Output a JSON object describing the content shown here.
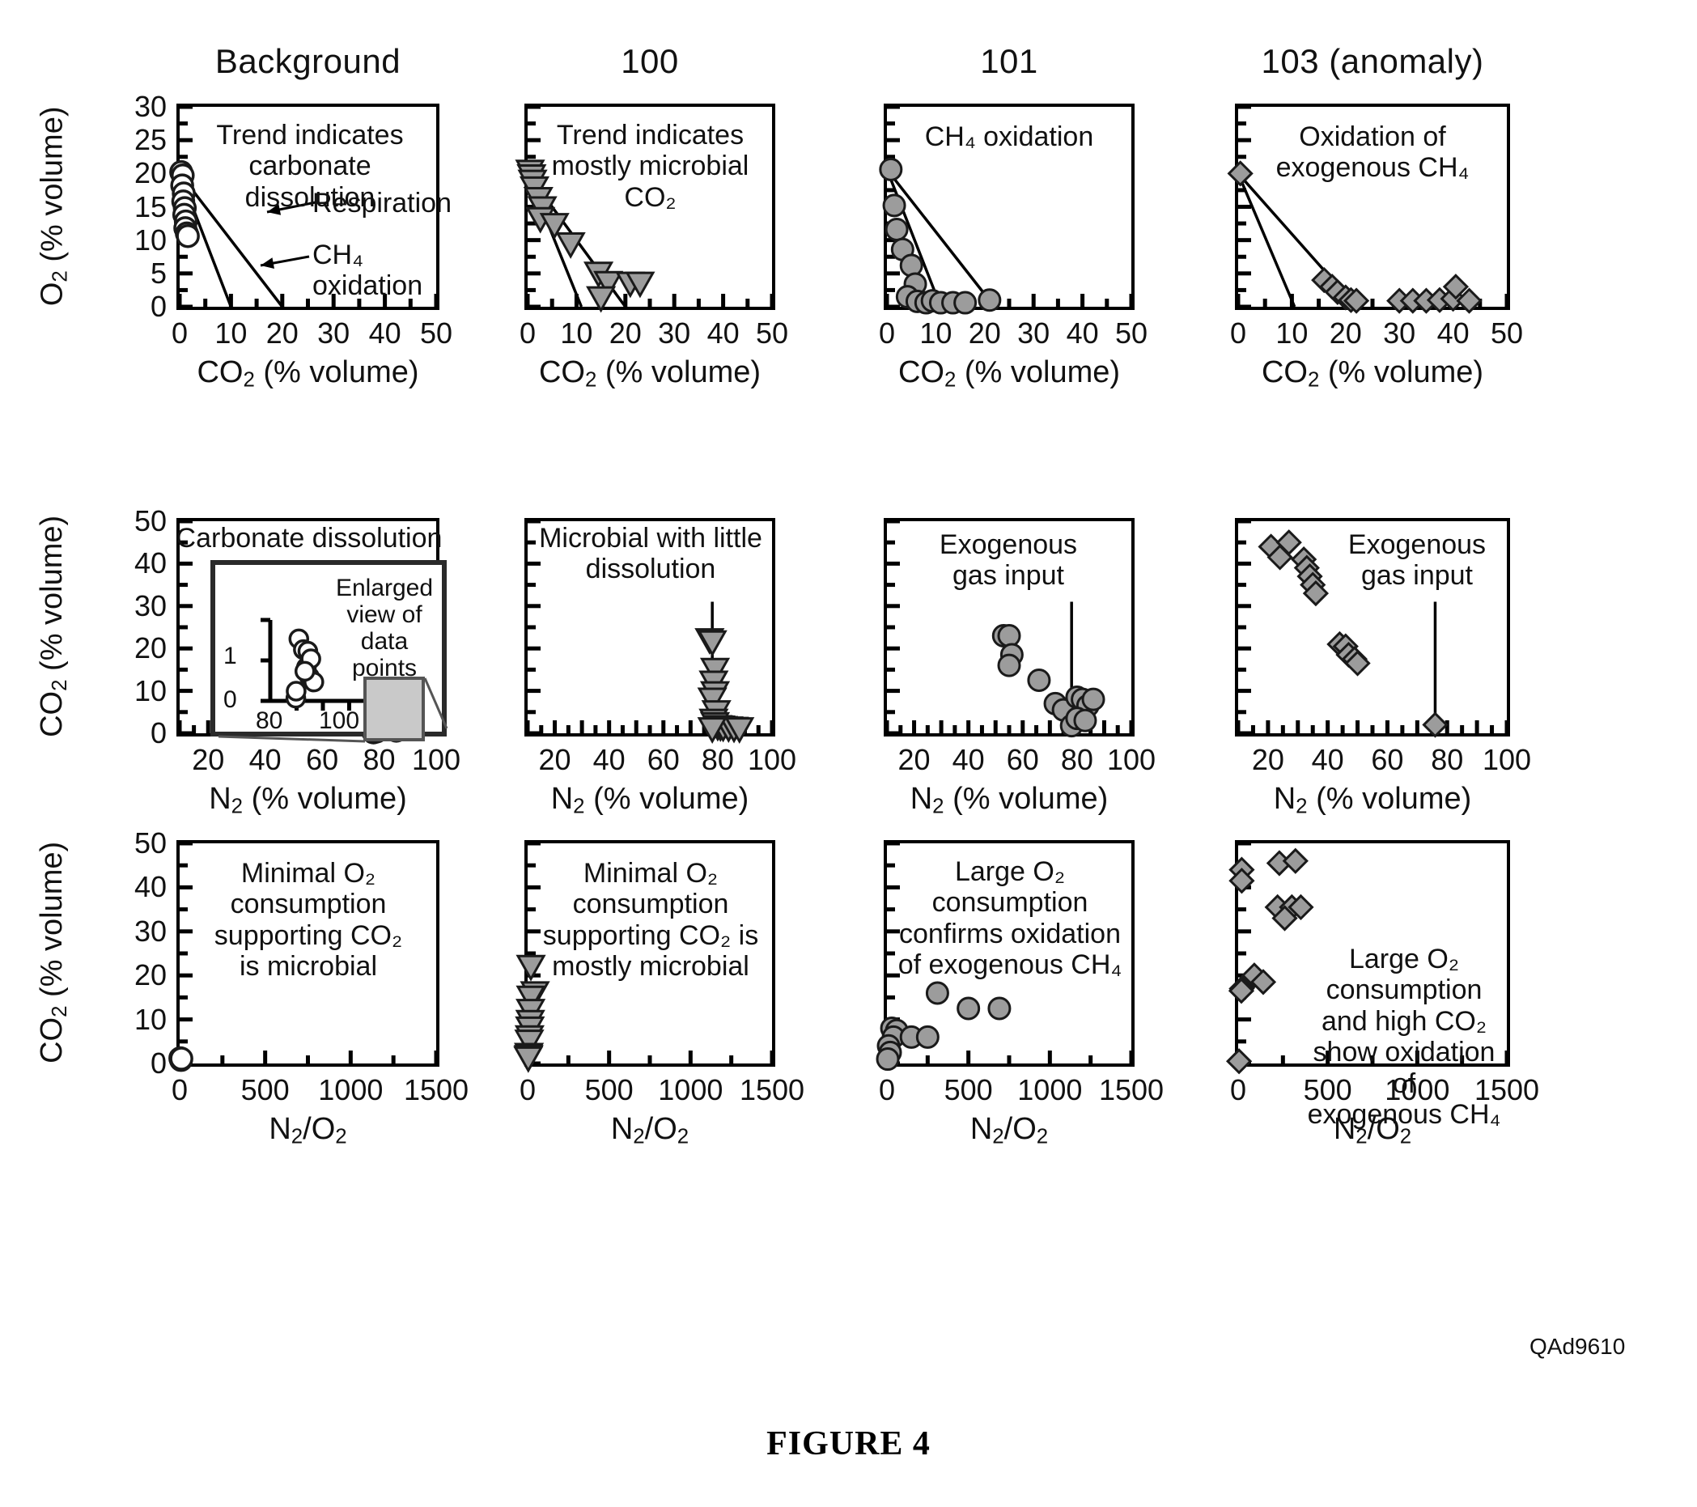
{
  "figure": {
    "caption": "FIGURE 4",
    "code": "QAd9610"
  },
  "columns": [
    {
      "id": "background",
      "title": "Background",
      "marker": "open-circle"
    },
    {
      "id": "site100",
      "title": "100",
      "marker": "triangle-down"
    },
    {
      "id": "site101",
      "title": "101",
      "marker": "filled-circle"
    },
    {
      "id": "site103",
      "title": "103 (anomaly)",
      "marker": "diamond"
    }
  ],
  "axes": {
    "co2_title": "CO₂ (% volume)",
    "o2_title": "O₂ (% volume)",
    "n2_title": "N₂ (% volume)",
    "ratio_title": "N₂/O₂",
    "row1_x_ticks": [
      "0",
      "10",
      "20",
      "30",
      "40",
      "50"
    ],
    "row1_y_ticks": [
      "0",
      "5",
      "10",
      "15",
      "20",
      "25",
      "30"
    ],
    "row2_x_ticks": [
      "20",
      "40",
      "60",
      "80",
      "100"
    ],
    "row2_y_ticks": [
      "0",
      "10",
      "20",
      "30",
      "40",
      "50"
    ],
    "row3_x_ticks": [
      "0",
      "500",
      "1000",
      "1500"
    ],
    "row3_y_ticks": [
      "0",
      "10",
      "20",
      "30",
      "40",
      "50"
    ]
  },
  "inset": {
    "label": "Enlarged\nview of\ndata\npoints",
    "y_ticks": [
      "0",
      "1"
    ],
    "x_ticks": [
      "80",
      "100"
    ]
  },
  "annotations": {
    "r1c1": "Trend indicates\ncarbonate\ndissolution",
    "r1c1_line1": "Respiration",
    "r1c1_line2": "CH₄\noxidation",
    "r1c2": "Trend indicates\nmostly microbial\nCO₂",
    "r1c3": "CH₄ oxidation",
    "r1c4": "Oxidation of\nexogenous CH₄",
    "r2c1": "Carbonate dissolution",
    "r2c2": "Microbial with little\ndissolution",
    "r2c3": "Exogenous\ngas input",
    "r2c4": "Exogenous\ngas input",
    "r3c1": "Minimal O₂\nconsumption\nsupporting CO₂\nis microbial",
    "r3c2": "Minimal O₂\nconsumption\nsupporting CO₂ is\nmostly microbial",
    "r3c3": "Large O₂\nconsumption\nconfirms oxidation\nof exogenous CH₄",
    "r3c4": "Large O₂\nconsumption\nand high CO₂\nshow oxidation of\nexogenous CH₄"
  },
  "colors": {
    "axis": "#000000",
    "marker_fill": "#9c9c9c",
    "marker_stroke": "#1a1a1a",
    "highlight": "#c9c9c9"
  },
  "chart_data": [
    {
      "id": "r1c1",
      "type": "scatter",
      "title": "Background",
      "xlabel": "CO2 (% volume)",
      "ylabel": "O2 (% volume)",
      "xlim": [
        0,
        50
      ],
      "ylim": [
        0,
        30
      ],
      "marker": "open-circle",
      "points": [
        [
          0.3,
          20.2
        ],
        [
          0.6,
          19.7
        ],
        [
          0.5,
          18.2
        ],
        [
          0.8,
          17.0
        ],
        [
          0.7,
          15.8
        ],
        [
          1.0,
          14.8
        ],
        [
          0.9,
          13.8
        ],
        [
          1.2,
          12.8
        ],
        [
          1.1,
          11.8
        ],
        [
          1.4,
          11.0
        ],
        [
          1.6,
          10.6
        ]
      ],
      "lines": [
        {
          "name": "Respiration",
          "from": [
            0,
            20
          ],
          "to": [
            20,
            0
          ]
        },
        {
          "name": "CH4 oxidation",
          "from": [
            0,
            20
          ],
          "to": [
            10,
            0
          ]
        }
      ],
      "annotations": [
        "Trend indicates carbonate dissolution",
        "Respiration",
        "CH4 oxidation"
      ]
    },
    {
      "id": "r1c2",
      "type": "scatter",
      "title": "100",
      "xlabel": "CO2 (% volume)",
      "ylabel": "O2 (% volume)",
      "xlim": [
        0,
        50
      ],
      "ylim": [
        0,
        30
      ],
      "marker": "triangle-down",
      "points": [
        [
          0.5,
          20.3
        ],
        [
          0.8,
          19.6
        ],
        [
          1.0,
          18.8
        ],
        [
          1.4,
          17.8
        ],
        [
          2.2,
          16.2
        ],
        [
          3.0,
          14.8
        ],
        [
          2.6,
          13.2
        ],
        [
          5.5,
          12.3
        ],
        [
          8.8,
          9.4
        ],
        [
          14.5,
          5.0
        ],
        [
          16.5,
          3.6
        ],
        [
          15.0,
          1.3
        ],
        [
          21.0,
          3.5
        ],
        [
          23.0,
          3.5
        ]
      ],
      "lines": [
        {
          "name": "line-a",
          "from": [
            0,
            20
          ],
          "to": [
            20,
            0
          ]
        },
        {
          "name": "line-b",
          "from": [
            0,
            20
          ],
          "to": [
            11,
            0
          ]
        }
      ],
      "annotations": [
        "Trend indicates mostly microbial CO2"
      ]
    },
    {
      "id": "r1c3",
      "type": "scatter",
      "title": "101",
      "xlabel": "CO2 (% volume)",
      "ylabel": "O2 (% volume)",
      "xlim": [
        0,
        50
      ],
      "ylim": [
        0,
        30
      ],
      "marker": "filled-circle",
      "points": [
        [
          0.8,
          20.6
        ],
        [
          1.5,
          15.2
        ],
        [
          2.0,
          11.6
        ],
        [
          3.2,
          8.6
        ],
        [
          5.0,
          6.2
        ],
        [
          5.8,
          3.4
        ],
        [
          4.2,
          1.5
        ],
        [
          6.2,
          0.8
        ],
        [
          8.0,
          0.6
        ],
        [
          9.3,
          0.9
        ],
        [
          11.0,
          0.6
        ],
        [
          13.5,
          0.6
        ],
        [
          16.0,
          0.6
        ],
        [
          21.0,
          1.0
        ]
      ],
      "lines": [
        {
          "name": "line-a",
          "from": [
            0,
            20.6
          ],
          "to": [
            22,
            0
          ]
        },
        {
          "name": "line-b",
          "from": [
            0,
            20.6
          ],
          "to": [
            11,
            0
          ]
        }
      ],
      "annotations": [
        "CH4 oxidation"
      ]
    },
    {
      "id": "r1c4",
      "type": "scatter",
      "title": "103 (anomaly)",
      "xlabel": "CO2 (% volume)",
      "ylabel": "O2 (% volume)",
      "xlim": [
        0,
        50
      ],
      "ylim": [
        0,
        30
      ],
      "marker": "diamond",
      "points": [
        [
          0.4,
          20.0
        ],
        [
          16.0,
          4.0
        ],
        [
          17.5,
          3.0
        ],
        [
          18.5,
          2.2
        ],
        [
          20.0,
          1.4
        ],
        [
          21.0,
          1.0
        ],
        [
          22.0,
          0.9
        ],
        [
          30.0,
          0.9
        ],
        [
          32.5,
          0.9
        ],
        [
          35.0,
          0.9
        ],
        [
          37.5,
          1.0
        ],
        [
          40.0,
          1.2
        ],
        [
          40.5,
          3.0
        ],
        [
          43.0,
          0.9
        ]
      ],
      "lines": [
        {
          "name": "line-a",
          "from": [
            0,
            20
          ],
          "to": [
            22,
            0
          ]
        },
        {
          "name": "line-b",
          "from": [
            0,
            20
          ],
          "to": [
            10.5,
            0
          ]
        }
      ],
      "annotations": [
        "Oxidation of exogenous CH4"
      ]
    },
    {
      "id": "r2c1",
      "type": "scatter",
      "title": "Background",
      "xlabel": "N2 (% volume)",
      "ylabel": "CO2 (% volume)",
      "xlim": [
        10,
        100
      ],
      "ylim": [
        0,
        50
      ],
      "marker": "open-circle",
      "points": [
        [
          78,
          0.2
        ],
        [
          79,
          0.4
        ],
        [
          80,
          1.0
        ],
        [
          81,
          1.1
        ],
        [
          82,
          1.2
        ],
        [
          83,
          1.4
        ],
        [
          84,
          1.0
        ],
        [
          85,
          0.9
        ],
        [
          86,
          0.6
        ]
      ],
      "annotations": [
        "Carbonate dissolution"
      ],
      "inset": {
        "label": "Enlarged view of data points",
        "xlim": [
          70,
          105
        ],
        "ylim": [
          0,
          1.5
        ],
        "x_ticks": [
          80,
          100
        ],
        "y_ticks": [
          0,
          1
        ],
        "points": [
          [
            78.5,
            0.05
          ],
          [
            78.6,
            0.18
          ],
          [
            79.5,
            1.15
          ],
          [
            81.0,
            0.95
          ],
          [
            82.5,
            0.92
          ],
          [
            82.0,
            0.62
          ],
          [
            83.5,
            0.78
          ],
          [
            83.0,
            0.45
          ],
          [
            84.5,
            0.35
          ],
          [
            81.5,
            0.55
          ]
        ]
      }
    },
    {
      "id": "r2c2",
      "type": "scatter",
      "title": "100",
      "xlabel": "N2 (% volume)",
      "ylabel": "CO2 (% volume)",
      "xlim": [
        10,
        100
      ],
      "ylim": [
        0,
        50
      ],
      "marker": "triangle-down",
      "points": [
        [
          77,
          22.0
        ],
        [
          78,
          21.5
        ],
        [
          79,
          15.0
        ],
        [
          78.5,
          12.0
        ],
        [
          79,
          9.5
        ],
        [
          78,
          8.0
        ],
        [
          79.5,
          5.0
        ],
        [
          78.5,
          3.0
        ],
        [
          79,
          2.2
        ],
        [
          80,
          1.5
        ],
        [
          81,
          1.4
        ],
        [
          82,
          1.3
        ],
        [
          84,
          1.2
        ],
        [
          86,
          1.1
        ],
        [
          88,
          1.0
        ],
        [
          78,
          1.0
        ]
      ],
      "vline_x": 78,
      "annotations": [
        "Microbial with little dissolution"
      ]
    },
    {
      "id": "r2c3",
      "type": "scatter",
      "title": "101",
      "xlabel": "N2 (% volume)",
      "ylabel": "CO2 (% volume)",
      "xlim": [
        10,
        100
      ],
      "ylim": [
        0,
        50
      ],
      "marker": "filled-circle",
      "points": [
        [
          53,
          23.0
        ],
        [
          55,
          23.0
        ],
        [
          56,
          18.5
        ],
        [
          55,
          16.0
        ],
        [
          66,
          12.5
        ],
        [
          72,
          7.0
        ],
        [
          75,
          5.5
        ],
        [
          78,
          1.8
        ],
        [
          80,
          8.5
        ],
        [
          82,
          8.0
        ],
        [
          84,
          6.5
        ],
        [
          86,
          8.0
        ],
        [
          80,
          3.5
        ],
        [
          83,
          3.0
        ]
      ],
      "vline_x": 78,
      "annotations": [
        "Exogenous gas input"
      ]
    },
    {
      "id": "r2c4",
      "type": "scatter",
      "title": "103 (anomaly)",
      "xlabel": "N2 (% volume)",
      "ylabel": "CO2 (% volume)",
      "xlim": [
        10,
        100
      ],
      "ylim": [
        0,
        50
      ],
      "marker": "diamond",
      "points": [
        [
          21,
          44.0
        ],
        [
          27,
          45.0
        ],
        [
          24,
          41.5
        ],
        [
          32,
          41.0
        ],
        [
          33,
          39.0
        ],
        [
          34,
          37.0
        ],
        [
          35,
          35.0
        ],
        [
          36,
          33.0
        ],
        [
          44,
          21.0
        ],
        [
          46,
          20.5
        ],
        [
          47,
          18.5
        ],
        [
          49,
          17.5
        ],
        [
          50,
          16.5
        ],
        [
          76,
          2.0
        ]
      ],
      "vline_x": 76,
      "annotations": [
        "Exogenous gas input"
      ]
    },
    {
      "id": "r3c1",
      "type": "scatter",
      "title": "Background",
      "xlabel": "N2/O2",
      "ylabel": "CO2 (% volume)",
      "xlim": [
        0,
        1500
      ],
      "ylim": [
        0,
        50
      ],
      "marker": "open-circle",
      "points": [
        [
          4,
          1.2
        ],
        [
          6,
          1.0
        ],
        [
          8,
          0.8
        ],
        [
          10,
          1.1
        ]
      ],
      "annotations": [
        "Minimal O2 consumption supporting CO2 is microbial"
      ]
    },
    {
      "id": "r3c2",
      "type": "scatter",
      "title": "100",
      "xlabel": "N2/O2",
      "ylabel": "CO2 (% volume)",
      "xlim": [
        0,
        1500
      ],
      "ylim": [
        0,
        50
      ],
      "marker": "triangle-down",
      "points": [
        [
          20,
          22.0
        ],
        [
          45,
          16.0
        ],
        [
          20,
          15.0
        ],
        [
          18,
          12.0
        ],
        [
          16,
          9.5
        ],
        [
          14,
          8.0
        ],
        [
          12,
          6.0
        ],
        [
          10,
          5.0
        ],
        [
          8,
          2.0
        ],
        [
          6,
          1.5
        ],
        [
          4,
          1.2
        ]
      ],
      "annotations": [
        "Minimal O2 consumption supporting CO2 is mostly microbial"
      ]
    },
    {
      "id": "r3c3",
      "type": "scatter",
      "title": "101",
      "xlabel": "N2/O2",
      "ylabel": "CO2 (% volume)",
      "xlim": [
        0,
        1500
      ],
      "ylim": [
        0,
        50
      ],
      "marker": "filled-circle",
      "points": [
        [
          310,
          16.0
        ],
        [
          500,
          12.5
        ],
        [
          690,
          12.5
        ],
        [
          30,
          8.0
        ],
        [
          60,
          7.5
        ],
        [
          40,
          6.0
        ],
        [
          150,
          6.0
        ],
        [
          250,
          6.0
        ],
        [
          10,
          4.0
        ],
        [
          20,
          2.5
        ],
        [
          5,
          1.0
        ]
      ],
      "annotations": [
        "Large O2 consumption confirms oxidation of exogenous CH4"
      ]
    },
    {
      "id": "r3c4",
      "type": "scatter",
      "title": "103 (anomaly)",
      "xlabel": "N2/O2",
      "ylabel": "CO2 (% volume)",
      "xlim": [
        0,
        1500
      ],
      "ylim": [
        0,
        50
      ],
      "marker": "diamond",
      "points": [
        [
          20,
          44.0
        ],
        [
          230,
          45.5
        ],
        [
          320,
          46.0
        ],
        [
          20,
          41.5
        ],
        [
          220,
          35.5
        ],
        [
          300,
          35.5
        ],
        [
          350,
          35.5
        ],
        [
          260,
          33.0
        ],
        [
          90,
          20.0
        ],
        [
          140,
          18.5
        ],
        [
          20,
          17.0
        ],
        [
          18,
          16.5
        ],
        [
          5,
          0.5
        ]
      ],
      "annotations": [
        "Large O2 consumption and high CO2 show oxidation of exogenous CH4"
      ]
    }
  ]
}
